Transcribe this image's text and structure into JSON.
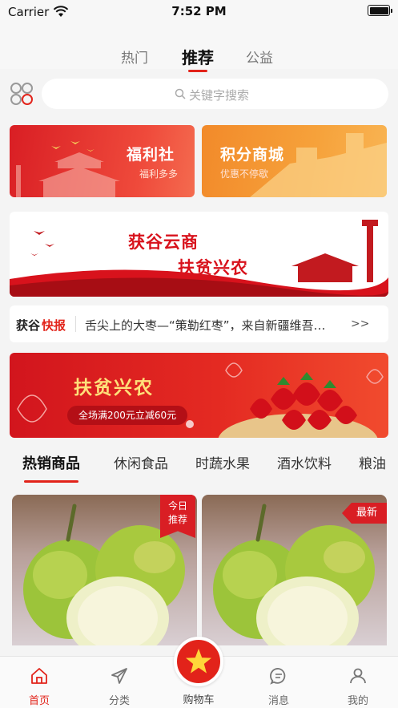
{
  "status_bar": {
    "carrier": "Carrier",
    "time": "7:52 PM"
  },
  "top_tabs": [
    {
      "label": "热门"
    },
    {
      "label": "推荐"
    },
    {
      "label": "公益"
    }
  ],
  "search": {
    "placeholder": "关键字搜索"
  },
  "promos": {
    "welfare": {
      "title": "福利社",
      "subtitle": "福利多多"
    },
    "points": {
      "title": "积分商城",
      "subtitle": "优惠不停歇"
    }
  },
  "banner_main": {
    "line1": "获谷云商",
    "line2": "扶贫兴农"
  },
  "news": {
    "brand_part1": "获谷",
    "brand_part2": "快报",
    "headline": "舌尖上的大枣—“策勒红枣”，来自新疆维吾尔自治区",
    "more": ">>"
  },
  "banner_fruit": {
    "title": "扶贫兴农",
    "promo": "全场满200元立减60元"
  },
  "category_tabs": [
    {
      "label": "热销商品"
    },
    {
      "label": "休闲食品"
    },
    {
      "label": "时蔬水果"
    },
    {
      "label": "酒水饮料"
    },
    {
      "label": "粮油"
    }
  ],
  "products": [
    {
      "badge_line1": "今日",
      "badge_line2": "推荐"
    },
    {
      "badge": "最新"
    }
  ],
  "tab_bar": {
    "home": "首页",
    "category": "分类",
    "cart": "购物车",
    "messages": "消息",
    "mine": "我的"
  },
  "colors": {
    "accent": "#e2231a",
    "brand_red": "#d91e24",
    "orange": "#f6a23b"
  }
}
